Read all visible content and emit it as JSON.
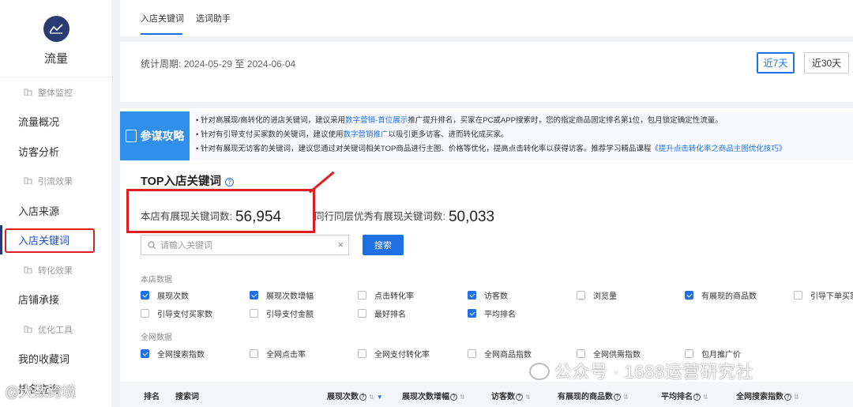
{
  "sidebar": {
    "title": "流量",
    "items": [
      {
        "label": "整体监控",
        "type": "sub"
      },
      {
        "label": "流量概况",
        "type": "item"
      },
      {
        "label": "访客分析",
        "type": "item"
      },
      {
        "label": "引流效果",
        "type": "sub"
      },
      {
        "label": "入店来源",
        "type": "item"
      },
      {
        "label": "入店关键词",
        "type": "item",
        "active": true
      },
      {
        "label": "转化效果",
        "type": "sub"
      },
      {
        "label": "店铺承接",
        "type": "item"
      },
      {
        "label": "优化工具",
        "type": "sub"
      },
      {
        "label": "我的收藏词",
        "type": "item"
      },
      {
        "label": "排名查询",
        "type": "item"
      }
    ]
  },
  "tabs": [
    {
      "label": "入店关键词",
      "active": true
    },
    {
      "label": "选词助手",
      "active": false
    }
  ],
  "period": {
    "label": "统计周期:",
    "start": "2024-05-29",
    "sep": "至",
    "end": "2024-06-04",
    "ranges": [
      {
        "label": "近7天",
        "active": true
      },
      {
        "label": "近30天",
        "active": false
      }
    ]
  },
  "tips": {
    "badge": "参谋攻略",
    "lines": [
      {
        "pre": "• 针对高展现/高转化的进店关键词，建议采用",
        "link": "数字营销-首位展示",
        "post": "推广提升排名，买家在PC或APP搜索时，您的指定商品固定排名第1位，包月锁定确定性流量。"
      },
      {
        "pre": "• 针对有引导支付买家数的关键词，建议使用",
        "link": "数字营销推广",
        "post": "以吸引更多访客、进而转化成买家。"
      },
      {
        "pre": "• 针对有展现无访客的关键词，建议您通过对关键词相关TOP商品进行主图、价格等优化，提高点击转化率以获得访客。推荐学习精品课程",
        "link": "《提升点击转化率之商品主图优化技巧》",
        "post": ""
      }
    ]
  },
  "top": {
    "title": "TOP入店关键词",
    "store_label": "本店有展现关键词数:",
    "store_value": "56,954",
    "peer_label": "同行同层优秀有展现关键词数:",
    "peer_value": "50,033",
    "search_placeholder": "请输入关键词",
    "search_button": "搜索"
  },
  "store_data": {
    "label": "本店数据",
    "options": [
      {
        "label": "展现次数",
        "checked": true
      },
      {
        "label": "展现次数增幅",
        "checked": true
      },
      {
        "label": "点击转化率",
        "checked": false
      },
      {
        "label": "访客数",
        "checked": true
      },
      {
        "label": "浏览量",
        "checked": false
      },
      {
        "label": "有展现的商品数",
        "checked": true
      },
      {
        "label": "引导下单买家",
        "checked": false
      },
      {
        "label": "引导支付买家数",
        "checked": false
      },
      {
        "label": "引导支付金额",
        "checked": false
      },
      {
        "label": "最好排名",
        "checked": false
      },
      {
        "label": "平均排名",
        "checked": true
      }
    ]
  },
  "net_data": {
    "label": "全网数据",
    "options": [
      {
        "label": "全网搜索指数",
        "checked": true
      },
      {
        "label": "全网点击率",
        "checked": false
      },
      {
        "label": "全网支付转化率",
        "checked": false
      },
      {
        "label": "全网商品指数",
        "checked": false
      },
      {
        "label": "全网供需指数",
        "checked": false
      },
      {
        "label": "包月推广价",
        "checked": false
      }
    ]
  },
  "table_headers": [
    "排名",
    "搜索词",
    "展现次数",
    "展现次数增幅",
    "访客数",
    "有展现的商品数",
    "平均排名",
    "全网搜索指数"
  ],
  "watermark": "公众号 · 1688运营研究社",
  "watermark2": "@大数跨境",
  "colors": {
    "accent": "#1f6fe5",
    "highlight": "#e02020",
    "brand": "#2a3b73"
  }
}
